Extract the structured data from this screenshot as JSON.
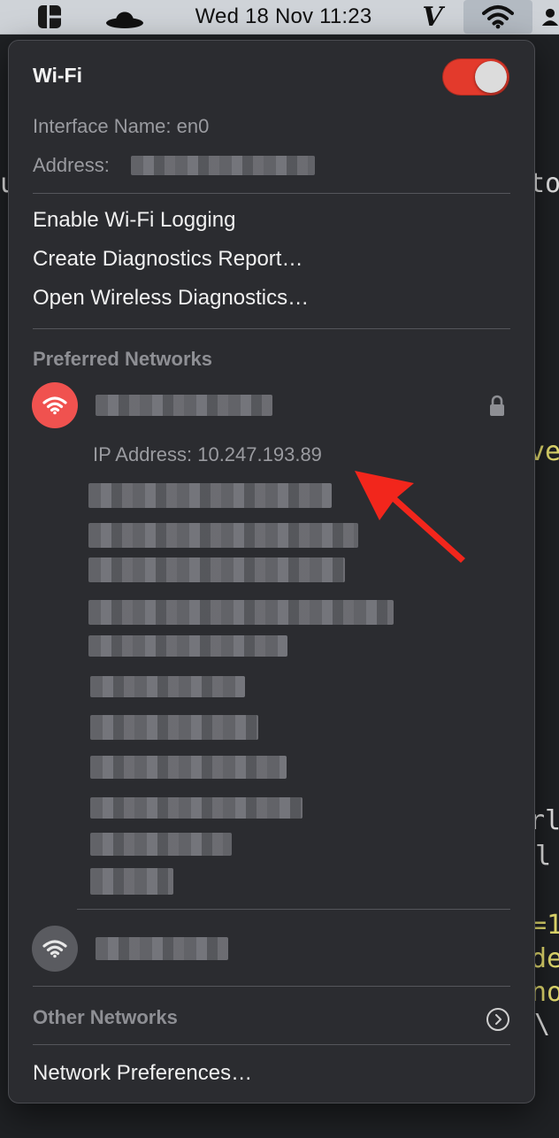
{
  "menubar": {
    "clock": "Wed 18 Nov  11:23",
    "icons": [
      "control-center-icon",
      "hat-icon",
      "vim-icon",
      "wifi-icon",
      "user-icon"
    ]
  },
  "wifi_menu": {
    "title": "Wi-Fi",
    "toggle_on": true,
    "interface_name": "Interface Name: en0",
    "address_label": "Address:",
    "actions": [
      "Enable Wi-Fi Logging",
      "Create Diagnostics Report…",
      "Open Wireless Diagnostics…"
    ],
    "preferred_heading": "Preferred Networks",
    "connected_ip": "IP Address: 10.247.193.89",
    "other_networks": "Other Networks",
    "network_preferences": "Network Preferences…"
  },
  "colors": {
    "accent": "#e33a2c",
    "connected_icon": "#f0524f",
    "panel": "#2b2c30",
    "annotation_arrow": "#f2261c"
  },
  "background_terminal": [
    "u",
    "to",
    "ve",
    "rl",
    "l",
    "=1",
    "de",
    "no",
    "\\"
  ]
}
